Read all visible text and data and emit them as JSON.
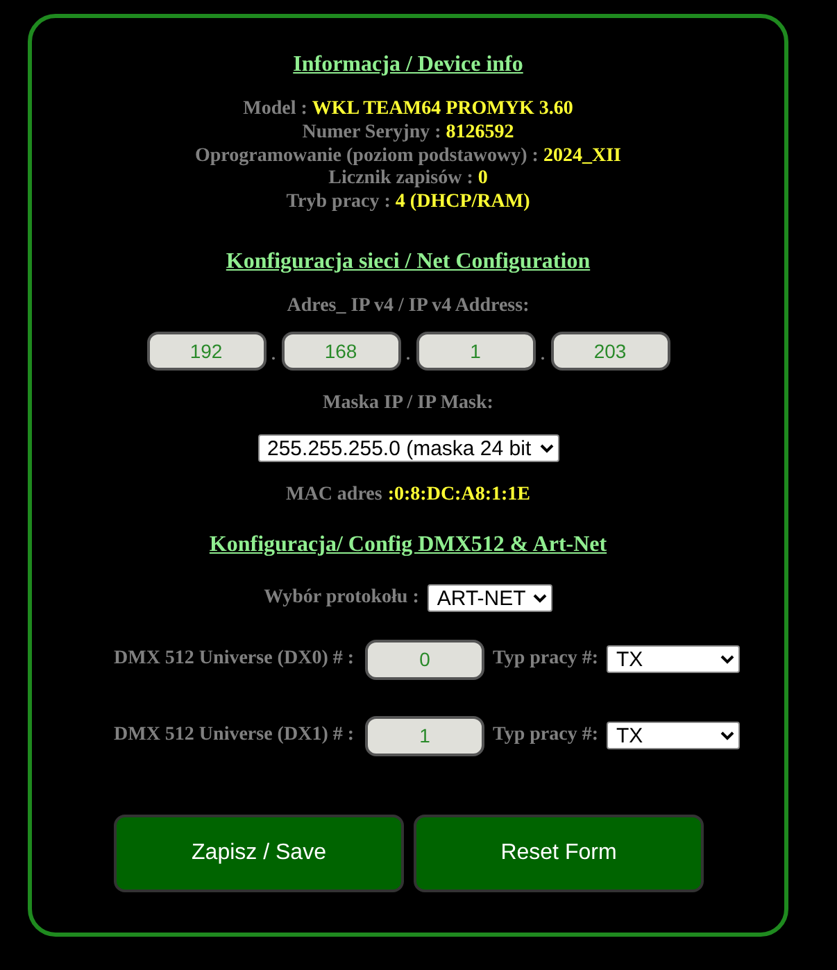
{
  "device_info": {
    "heading": "Informacja / Device info",
    "lines": [
      {
        "label": "Model :",
        "value": "WKL TEAM64 PROMYK 3.60"
      },
      {
        "label": "Numer Seryjny :",
        "value": "8126592"
      },
      {
        "label": "Oprogramowanie (poziom podstawowy) :",
        "value": "2024_XII"
      },
      {
        "label": "Licznik zapisów :",
        "value": "0"
      },
      {
        "label": "Tryb pracy :",
        "value": "4 (DHCP/RAM)"
      }
    ]
  },
  "net_config": {
    "heading": "Konfiguracja sieci / Net Configuration",
    "ip_label": "Adres_ IP v4 / IP v4 Address:",
    "ip_octets": [
      "192",
      "168",
      "1",
      "203"
    ],
    "ip_separator": ".",
    "mask_label": "Maska IP / IP Mask:",
    "mask_value": "255.255.255.0 (maska 24 bit",
    "mac_label": "MAC adres",
    "mac_value": ":0:8:DC:A8:1:1E"
  },
  "dmx_config": {
    "heading": "Konfiguracja/ Config DMX512 & Art-Net",
    "protocol_label": "Wybór protokołu :",
    "protocol_value": "ART-NET",
    "universes": [
      {
        "label": "DMX 512 Universe (DX0) # :",
        "value": "0",
        "mode_label": "Typ pracy #:",
        "mode_value": "TX"
      },
      {
        "label": "DMX 512 Universe (DX1) # :",
        "value": "1",
        "mode_label": "Typ pracy #:",
        "mode_value": "TX"
      }
    ]
  },
  "buttons": [
    "Zapisz / Save",
    "Reset Form"
  ]
}
